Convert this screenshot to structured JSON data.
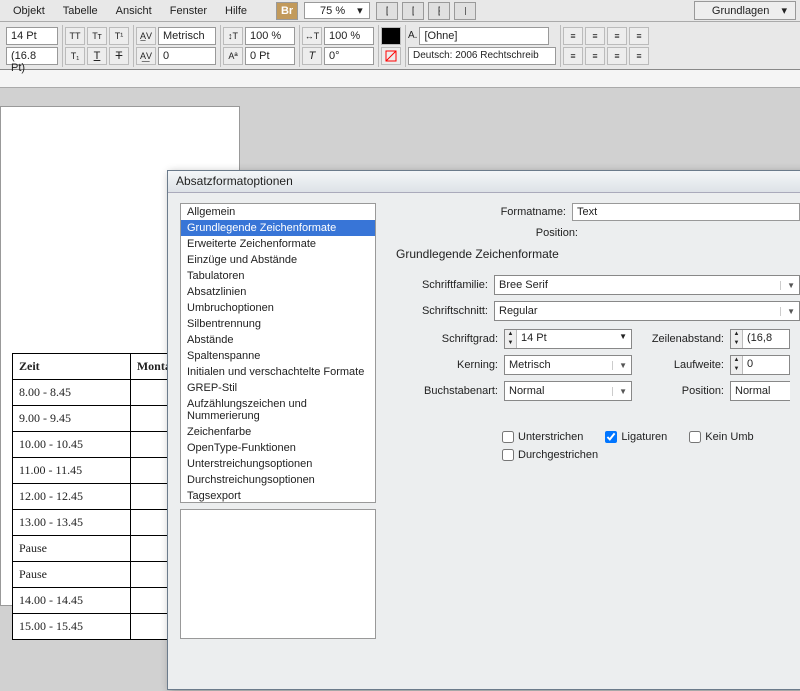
{
  "menu": {
    "items": [
      "Objekt",
      "Tabelle",
      "Ansicht",
      "Fenster",
      "Hilfe"
    ],
    "zoom": "75 %",
    "workspace": "Grundlagen"
  },
  "toolbar": {
    "fontsize": "14 Pt",
    "leading": "(16.8 Pt)",
    "metric": "Metrisch",
    "scale1": "100 %",
    "scale2": "100 %",
    "kerning": "0",
    "baseline": "0 Pt",
    "charstyle": "[Ohne]",
    "lang": "Deutsch: 2006 Rechtschreib"
  },
  "doc": {
    "col1": "Zeit",
    "col2": "Montag",
    "rows": [
      "8.00 - 8.45",
      "9.00 - 9.45",
      "10.00 - 10.45",
      "11.00 - 11.45",
      "12.00 - 12.45",
      "13.00 - 13.45",
      "Pause",
      "Pause",
      "14.00 - 14.45",
      "15.00 - 15.45"
    ]
  },
  "dialog": {
    "title": "Absatzformatoptionen",
    "nav": [
      "Allgemein",
      "Grundlegende Zeichenformate",
      "Erweiterte Zeichenformate",
      "Einzüge und Abstände",
      "Tabulatoren",
      "Absatzlinien",
      "Umbruchoptionen",
      "Silbentrennung",
      "Abstände",
      "Spaltenspanne",
      "Initialen und verschachtelte Formate",
      "GREP-Stil",
      "Aufzählungszeichen und Nummerierung",
      "Zeichenfarbe",
      "OpenType-Funktionen",
      "Unterstreichungsoptionen",
      "Durchstreichungsoptionen",
      "Tagsexport"
    ],
    "nav_selected": 1,
    "formatname_lbl": "Formatname:",
    "formatname": "Text",
    "position_lbl": "Position:",
    "section": "Grundlegende Zeichenformate",
    "fontfamily_lbl": "Schriftfamilie:",
    "fontfamily": "Bree Serif",
    "fontstyle_lbl": "Schriftschnitt:",
    "fontstyle": "Regular",
    "size_lbl": "Schriftgrad:",
    "size": "14 Pt",
    "leading_lbl": "Zeilenabstand:",
    "leading": "(16,8",
    "kerning_lbl": "Kerning:",
    "kerning": "Metrisch",
    "tracking_lbl": "Laufweite:",
    "tracking": "0",
    "case_lbl": "Buchstabenart:",
    "case": "Normal",
    "position2_lbl": "Position:",
    "position2": "Normal",
    "chk_under": "Unterstrichen",
    "chk_lig": "Ligaturen",
    "chk_umbr": "Kein Umb",
    "chk_strike": "Durchgestrichen"
  }
}
